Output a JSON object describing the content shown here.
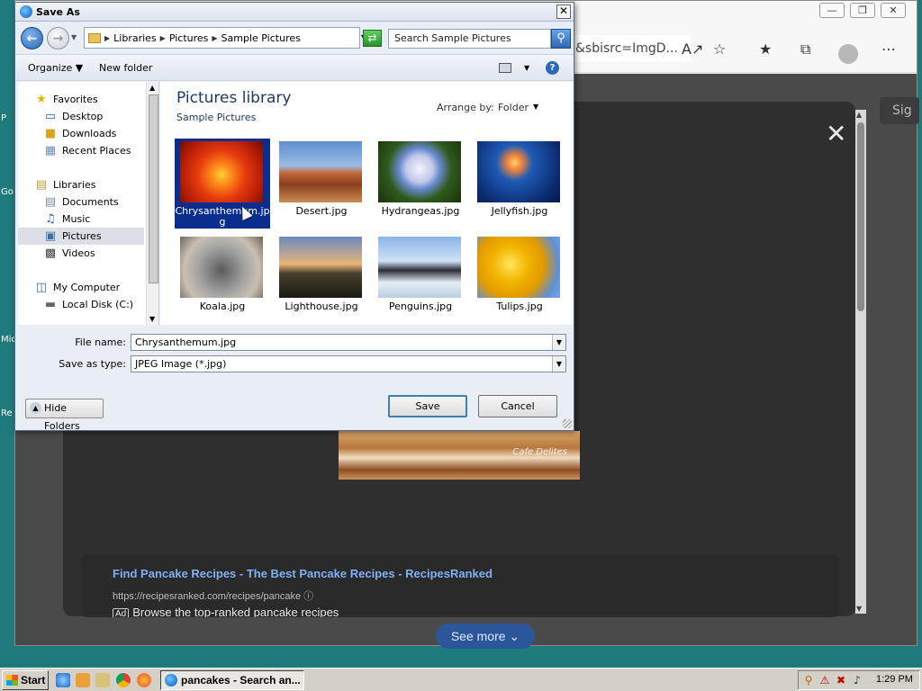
{
  "desktop": {
    "fragments": [
      "P",
      "Go",
      "Mic",
      "Re"
    ]
  },
  "browser": {
    "address_fragment": "&sbisrc=ImgD...",
    "signin_label": "Sig",
    "ad": {
      "title": "Find Pancake Recipes - The Best Pancake Recipes - RecipesRanked",
      "url": "https://recipesranked.com/recipes/pancake",
      "badge": "Ad",
      "description": "Browse the top-ranked pancake recipes"
    },
    "see_more": "See more",
    "watermark": "Cafe Delites"
  },
  "dialog": {
    "title": "Save As",
    "breadcrumb": [
      "Libraries",
      "Pictures",
      "Sample Pictures"
    ],
    "search_placeholder": "Search Sample Pictures",
    "toolbar": {
      "organize": "Organize",
      "new_folder": "New folder"
    },
    "nav": {
      "favorites": "Favorites",
      "desktop": "Desktop",
      "downloads": "Downloads",
      "recent_places": "Recent Places",
      "libraries": "Libraries",
      "documents": "Documents",
      "music": "Music",
      "pictures": "Pictures",
      "videos": "Videos",
      "my_computer": "My Computer",
      "local_disk": "Local Disk (C:)"
    },
    "library": {
      "title": "Pictures library",
      "subtitle": "Sample Pictures",
      "arrange_label": "Arrange by:",
      "arrange_value": "Folder"
    },
    "files": [
      {
        "name": "Chrysanthemum.jpg",
        "caption": "Chrysanthemum.jpg",
        "selected": true,
        "thumb": "chrys"
      },
      {
        "name": "Desert.jpg",
        "caption": "Desert.jpg",
        "selected": false,
        "thumb": "desert"
      },
      {
        "name": "Hydrangeas.jpg",
        "caption": "Hydrangeas.jpg",
        "selected": false,
        "thumb": "hydra"
      },
      {
        "name": "Jellyfish.jpg",
        "caption": "Jellyfish.jpg",
        "selected": false,
        "thumb": "jelly"
      },
      {
        "name": "Koala.jpg",
        "caption": "Koala.jpg",
        "selected": false,
        "thumb": "koala"
      },
      {
        "name": "Lighthouse.jpg",
        "caption": "Lighthouse.jpg",
        "selected": false,
        "thumb": "light"
      },
      {
        "name": "Penguins.jpg",
        "caption": "Penguins.jpg",
        "selected": false,
        "thumb": "peng"
      },
      {
        "name": "Tulips.jpg",
        "caption": "Tulips.jpg",
        "selected": false,
        "thumb": "tulip"
      }
    ],
    "filename_label": "File name:",
    "filename_value": "Chrysanthemum.jpg",
    "savetype_label": "Save as type:",
    "savetype_value": "JPEG Image (*.jpg)",
    "save_button": "Save",
    "cancel_button": "Cancel",
    "hide_folders": "Hide Folders"
  },
  "taskbar": {
    "start": "Start",
    "active_task": "pancakes - Search an...",
    "clock": "1:29 PM"
  },
  "colors": {
    "desktop_bg": "#1f7a7c",
    "selection": "#0b2d8e",
    "library_title": "#1e3963",
    "ad_title": "#7fb0f5"
  }
}
